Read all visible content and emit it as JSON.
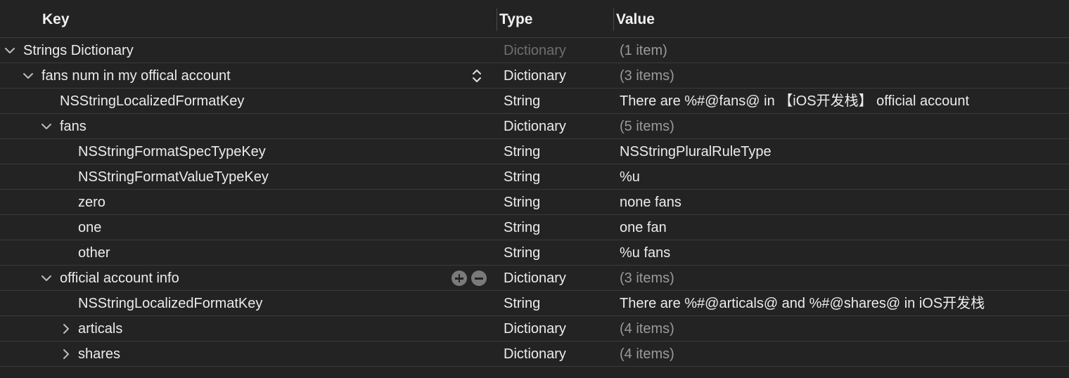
{
  "header": {
    "key": "Key",
    "type": "Type",
    "value": "Value"
  },
  "icons": {
    "expanded": "chevron-down-icon",
    "collapsed": "chevron-right-icon",
    "type_popup": "up-down-chevron-icon",
    "add": "plus-circle-icon",
    "remove": "minus-circle-icon"
  },
  "colors": {
    "background": "#232323",
    "text": "#ececec",
    "dim_text": "#9a9a9a",
    "dimmer_text": "#6e6e6e",
    "separator": "#3a3a3a"
  },
  "rows": [
    {
      "key": "Strings Dictionary",
      "type": "Dictionary",
      "value": "(1 item)"
    },
    {
      "key": "fans num in my offical account",
      "type": "Dictionary",
      "value": "(3 items)"
    },
    {
      "key": "NSStringLocalizedFormatKey",
      "type": "String",
      "value": "There are %#@fans@ in 【iOS开发栈】 official account"
    },
    {
      "key": "fans",
      "type": "Dictionary",
      "value": "(5 items)"
    },
    {
      "key": "NSStringFormatSpecTypeKey",
      "type": "String",
      "value": "NSStringPluralRuleType"
    },
    {
      "key": "NSStringFormatValueTypeKey",
      "type": "String",
      "value": "%u"
    },
    {
      "key": "zero",
      "type": "String",
      "value": "none fans"
    },
    {
      "key": "one",
      "type": "String",
      "value": "one fan"
    },
    {
      "key": "other",
      "type": "String",
      "value": "%u fans"
    },
    {
      "key": "official account info",
      "type": "Dictionary",
      "value": "(3 items)"
    },
    {
      "key": "NSStringLocalizedFormatKey",
      "type": "String",
      "value": "There are %#@articals@ and %#@shares@ in iOS开发栈"
    },
    {
      "key": "articals",
      "type": "Dictionary",
      "value": "(4 items)"
    },
    {
      "key": "shares",
      "type": "Dictionary",
      "value": "(4 items)"
    }
  ]
}
